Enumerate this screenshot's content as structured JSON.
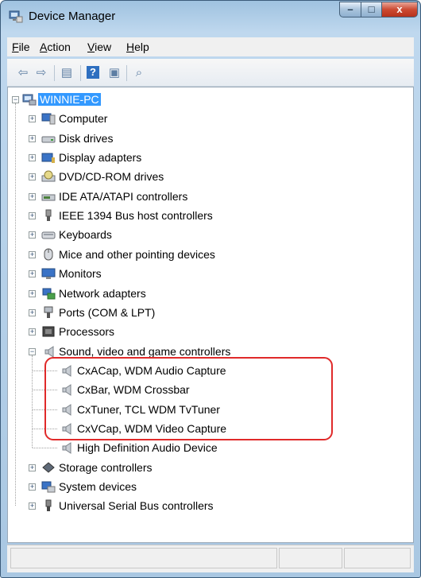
{
  "window": {
    "title": "Device Manager",
    "icon": "device-manager-icon"
  },
  "title_buttons": {
    "minimize": "–",
    "maximize": "□",
    "close": "x"
  },
  "menu": [
    {
      "label": "File"
    },
    {
      "label": "Action"
    },
    {
      "label": "View"
    },
    {
      "label": "Help"
    }
  ],
  "toolbar": [
    {
      "icon": "back-arrow-icon",
      "glyph": "⇦"
    },
    {
      "icon": "forward-arrow-icon",
      "glyph": "⇨"
    },
    {
      "icon": "properties-icon",
      "glyph": "▤"
    },
    {
      "icon": "help-icon",
      "glyph": "?"
    },
    {
      "icon": "update-driver-icon",
      "glyph": "▣"
    },
    {
      "icon": "scan-hardware-icon",
      "glyph": "⌕"
    }
  ],
  "tree": {
    "root": {
      "label": "WINNIE-PC",
      "icon": "computer-network-icon",
      "expanded": true,
      "selected": true
    },
    "categories": [
      {
        "label": "Computer",
        "icon": "computer-icon"
      },
      {
        "label": "Disk drives",
        "icon": "disk-drive-icon"
      },
      {
        "label": "Display adapters",
        "icon": "display-adapter-icon"
      },
      {
        "label": "DVD/CD-ROM drives",
        "icon": "dvd-drive-icon"
      },
      {
        "label": "IDE ATA/ATAPI controllers",
        "icon": "ide-controller-icon"
      },
      {
        "label": "IEEE 1394 Bus host controllers",
        "icon": "ieee1394-icon"
      },
      {
        "label": "Keyboards",
        "icon": "keyboard-icon"
      },
      {
        "label": "Mice and other pointing devices",
        "icon": "mouse-icon"
      },
      {
        "label": "Monitors",
        "icon": "monitor-icon"
      },
      {
        "label": "Network adapters",
        "icon": "network-adapter-icon"
      },
      {
        "label": "Ports (COM & LPT)",
        "icon": "port-icon"
      },
      {
        "label": "Processors",
        "icon": "processor-icon"
      },
      {
        "label": "Sound, video and game controllers",
        "icon": "speaker-icon",
        "expanded": true,
        "children": [
          {
            "label": "CxACap, WDM Audio Capture",
            "icon": "speaker-icon"
          },
          {
            "label": "CxBar, WDM Crossbar",
            "icon": "speaker-icon"
          },
          {
            "label": "CxTuner, TCL WDM TvTuner",
            "icon": "speaker-icon"
          },
          {
            "label": "CxVCap, WDM Video Capture",
            "icon": "speaker-icon"
          },
          {
            "label": "High Definition Audio Device",
            "icon": "speaker-icon"
          }
        ]
      },
      {
        "label": "Storage controllers",
        "icon": "storage-controller-icon"
      },
      {
        "label": "System devices",
        "icon": "system-devices-icon"
      },
      {
        "label": "Universal Serial Bus controllers",
        "icon": "usb-icon"
      }
    ]
  },
  "colors": {
    "selection": "#3399ff",
    "annotation": "#e02a2a",
    "title_bar": "#bfd8ee"
  }
}
